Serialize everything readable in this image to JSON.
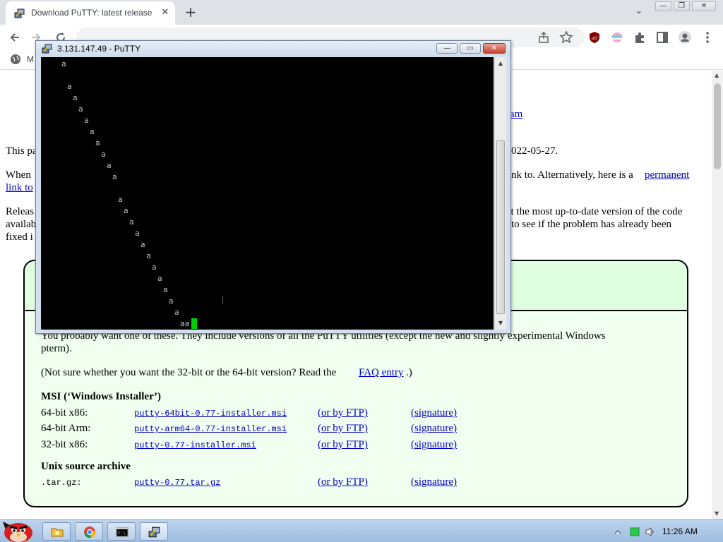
{
  "browser": {
    "tab_title": "Download PuTTY: latest release (",
    "tab_close": "✕",
    "new_tab": "+",
    "tab_search": "⌄",
    "window_controls": {
      "minimize": "—",
      "restore": "❐",
      "close": "✕"
    },
    "bookmark_initial": "M"
  },
  "page": {
    "snippet_link_am": "am",
    "line_this_pa": "This pa",
    "line_date": "022-05-27.",
    "line_when": "When",
    "line_link_to": "link to",
    "line_nk_to": "nk to. Alternatively, here is a",
    "permanent": "permanent",
    "line_releas": "Releas",
    "line_availab": "availab",
    "line_fixed": "fixed i",
    "line_most_up_to_date": "ot the most up-to-date version of the code",
    "line_to_see": "to see if the problem has already been",
    "intro_line1": "You probably want one of these. They include versions of all the PuTTY utilities (except the new and slightly experimental Windows",
    "intro_line2": "pterm).",
    "faq_prefix": "(Not sure whether you want the 32-bit or the 64-bit version? Read the",
    "faq_link": "FAQ entry",
    "faq_suffix": ".)",
    "msi_heading": "MSI (‘Windows Installer’)",
    "msi_rows": [
      {
        "label": "64-bit x86:",
        "file": "putty-64bit-0.77-installer.msi",
        "ftp": "(or by FTP)",
        "sig": "(signature)"
      },
      {
        "label": "64-bit Arm:",
        "file": "putty-arm64-0.77-installer.msi",
        "ftp": "(or by FTP)",
        "sig": "(signature)"
      },
      {
        "label": "32-bit x86:",
        "file": "putty-0.77-installer.msi",
        "ftp": "(or by FTP)",
        "sig": "(signature)"
      }
    ],
    "unix_heading": "Unix source archive",
    "unix_row": {
      "label": ".tar.gz:",
      "file": "putty-0.77.tar.gz",
      "ftp": "(or by FTP)",
      "sig": "(signature)"
    }
  },
  "putty": {
    "title": "3.131.147.49 - PuTTY",
    "terminal_lines": [
      {
        "row": 0,
        "col": 3,
        "text": "a"
      },
      {
        "row": 2,
        "col": 4,
        "text": "a"
      },
      {
        "row": 3,
        "col": 5,
        "text": "a"
      },
      {
        "row": 4,
        "col": 6,
        "text": "a"
      },
      {
        "row": 5,
        "col": 7,
        "text": "a"
      },
      {
        "row": 6,
        "col": 8,
        "text": "a"
      },
      {
        "row": 7,
        "col": 9,
        "text": "a"
      },
      {
        "row": 8,
        "col": 10,
        "text": "a"
      },
      {
        "row": 9,
        "col": 11,
        "text": "a"
      },
      {
        "row": 10,
        "col": 12,
        "text": "a"
      },
      {
        "row": 12,
        "col": 13,
        "text": "a"
      },
      {
        "row": 13,
        "col": 14,
        "text": "a"
      },
      {
        "row": 14,
        "col": 15,
        "text": "a"
      },
      {
        "row": 15,
        "col": 16,
        "text": "a"
      },
      {
        "row": 16,
        "col": 17,
        "text": "a"
      },
      {
        "row": 17,
        "col": 18,
        "text": "a"
      },
      {
        "row": 18,
        "col": 19,
        "text": "a"
      },
      {
        "row": 19,
        "col": 20,
        "text": "a"
      },
      {
        "row": 20,
        "col": 21,
        "text": "a"
      },
      {
        "row": 21,
        "col": 22,
        "text": "a"
      },
      {
        "row": 22,
        "col": 23,
        "text": "a"
      },
      {
        "row": 23,
        "col": 24,
        "text": "aa"
      }
    ]
  },
  "taskbar": {
    "clock": "11:26 AM",
    "apps": [
      "angry-birds-start",
      "file-explorer",
      "chrome",
      "cmd",
      "putty"
    ]
  }
}
